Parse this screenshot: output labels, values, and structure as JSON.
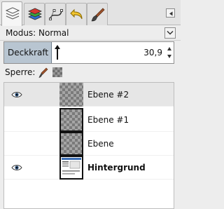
{
  "tabs": [
    {
      "id": "layers",
      "icon": "layers-stack-icon",
      "active": true
    },
    {
      "id": "channels",
      "icon": "channels-icon",
      "active": false
    },
    {
      "id": "paths",
      "icon": "paths-icon",
      "active": false
    },
    {
      "id": "undo",
      "icon": "undo-history-icon",
      "active": false
    },
    {
      "id": "brushes",
      "icon": "brush-icon",
      "active": false
    }
  ],
  "mode": {
    "label": "Modus: Normal"
  },
  "opacity": {
    "label": "Deckkraft",
    "value": "30,9",
    "percent": 30.9
  },
  "lock": {
    "label": "Sperre:"
  },
  "layers": [
    {
      "name": "Ebene #2",
      "visible": true,
      "selected": true,
      "bold": false
    },
    {
      "name": "Ebene #1",
      "visible": false,
      "selected": false,
      "bold": false
    },
    {
      "name": "Ebene",
      "visible": false,
      "selected": false,
      "bold": false
    },
    {
      "name": "Hintergrund",
      "visible": true,
      "selected": false,
      "bold": true
    }
  ]
}
